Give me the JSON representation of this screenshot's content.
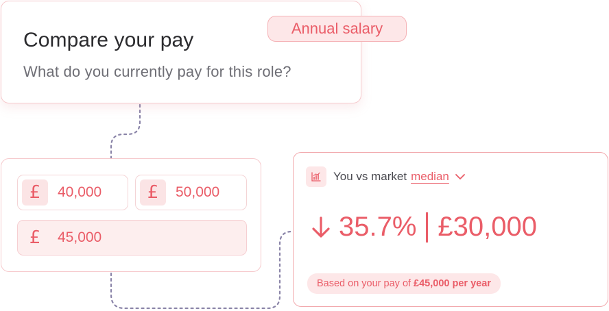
{
  "question_card": {
    "title": "Compare your pay",
    "subtitle": "What do you currently pay for this role?",
    "tag": "Annual salary"
  },
  "salary_inputs": {
    "currency_symbol": "£",
    "options": [
      {
        "value": "40,000",
        "selected": false
      },
      {
        "value": "50,000",
        "selected": false
      },
      {
        "value": "45,000",
        "selected": true
      }
    ]
  },
  "result_card": {
    "icon": "chart-icon",
    "label": "You vs market",
    "dropdown_value": "median",
    "direction": "down",
    "difference_percent": "35.7%",
    "difference_amount": "£30,000",
    "note_prefix": "Based on your pay of",
    "note_value": "£45,000 per year"
  },
  "colors": {
    "accent": "#ea5d68",
    "accent_light": "#fde7e8",
    "border": "#f6c9cc",
    "connector": "#8a84a8",
    "title_text": "#2b2b2e",
    "muted_text": "#6f6f76"
  }
}
